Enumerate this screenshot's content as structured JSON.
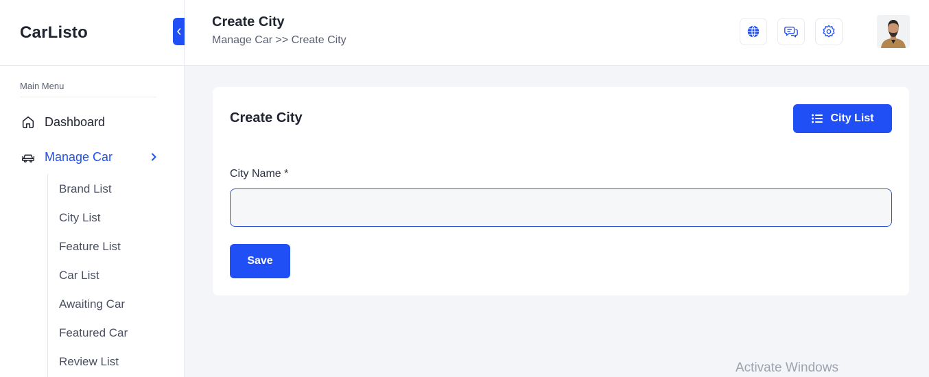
{
  "brand": {
    "name": "CarListo"
  },
  "sidebar": {
    "caption": "Main Menu",
    "items": [
      {
        "label": "Dashboard",
        "icon": "home-icon"
      },
      {
        "label": "Manage Car",
        "icon": "car-icon",
        "active": true
      }
    ],
    "submenu": [
      {
        "label": "Brand List"
      },
      {
        "label": "City List"
      },
      {
        "label": "Feature List"
      },
      {
        "label": "Car List"
      },
      {
        "label": "Awaiting Car"
      },
      {
        "label": "Featured Car"
      },
      {
        "label": "Review List"
      }
    ]
  },
  "header": {
    "title": "Create City",
    "breadcrumb": "Manage Car >> Create City",
    "icons": [
      "globe-icon",
      "chat-icon",
      "gear-icon"
    ]
  },
  "card": {
    "title": "Create City",
    "list_button": "City List",
    "field_label": "City Name *",
    "field_value": "",
    "save_label": "Save"
  },
  "watermark": "Activate Windows",
  "colors": {
    "accent": "#1f4ff5",
    "background": "#f3f5f9",
    "card": "#ffffff"
  }
}
